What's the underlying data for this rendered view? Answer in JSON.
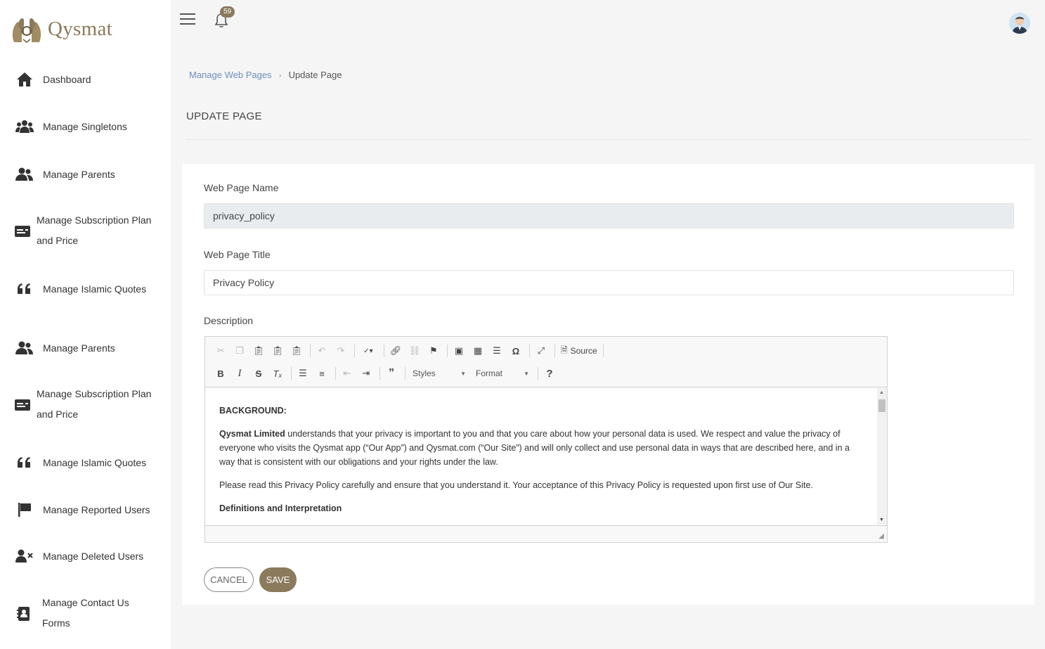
{
  "app": {
    "name": "Qysmat"
  },
  "header": {
    "notification_count": "59"
  },
  "sidebar": {
    "items": [
      {
        "label": "Dashboard",
        "icon": "home-icon"
      },
      {
        "label": "Manage Singletons",
        "icon": "users-icon"
      },
      {
        "label": "Manage Parents",
        "icon": "user-group-icon"
      },
      {
        "label": "Manage Subscription Plan and Price",
        "line1": "Manage Subscription Plan",
        "line2": "and Price",
        "icon": "card-icon"
      },
      {
        "label": "Manage Islamic Quotes",
        "icon": "quote-icon"
      },
      {
        "label": "Manage Parents",
        "icon": "user-group-icon"
      },
      {
        "label": "Manage Subscription Plan and Price",
        "line1": "Manage Subscription Plan",
        "line2": "and Price",
        "icon": "card-icon"
      },
      {
        "label": "Manage Islamic Quotes",
        "icon": "quote-icon"
      },
      {
        "label": "Manage Reported Users",
        "icon": "flag-icon"
      },
      {
        "label": "Manage Deleted Users",
        "icon": "user-remove-icon"
      },
      {
        "label": "Manage Contact Us Forms",
        "line1": "Manage Contact Us",
        "line2": "Forms",
        "icon": "contact-card-icon"
      }
    ]
  },
  "breadcrumb": {
    "parent": "Manage Web Pages",
    "current": "Update Page"
  },
  "page": {
    "title": "UPDATE PAGE"
  },
  "form": {
    "name_label": "Web Page Name",
    "name_value": "privacy_policy",
    "title_label": "Web Page Title",
    "title_value": "Privacy Policy",
    "description_label": "Description"
  },
  "editor": {
    "source_label": "Source",
    "styles_label": "Styles",
    "format_label": "Format",
    "content": {
      "heading": "BACKGROUND:",
      "p1_bold": "Qysmat Limited",
      "p1_rest": " understands that your privacy is important to you and that you care about how your personal data is used. We respect and value the privacy of everyone who visits the Qysmat app (“Our App”) and Qysmat.com (“Our Site”) and will only collect and use personal data in ways that are described here, and in a way that is consistent with our obligations and your rights under the law.",
      "p2": "Please read this Privacy Policy carefully and ensure that you understand it. Your acceptance of this Privacy Policy is requested upon first use of Our Site.",
      "subheading": "Definitions and Interpretation"
    }
  },
  "actions": {
    "cancel_label": "CANCEL",
    "save_label": "SAVE"
  },
  "colors": {
    "brand": "#8b7a5c",
    "link": "#6e8fbf"
  }
}
